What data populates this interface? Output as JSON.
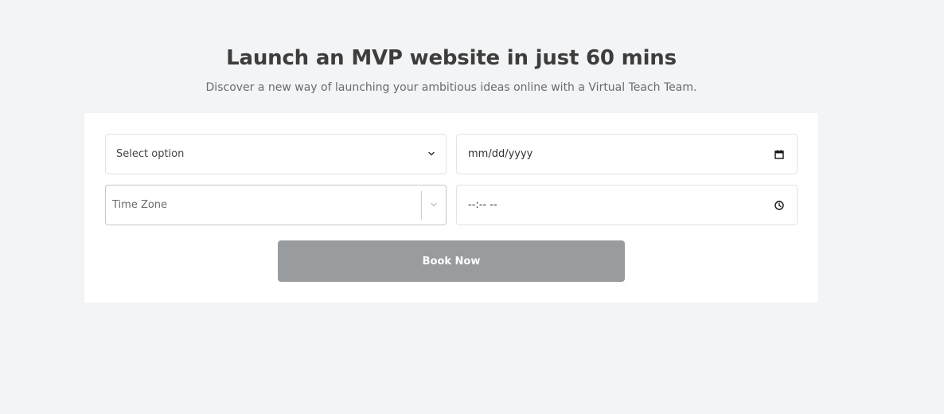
{
  "hero": {
    "title": "Launch an MVP website in just 60 mins",
    "subtitle": "Discover a new way of launching your ambitious ideas online with a Virtual Teach Team."
  },
  "form": {
    "service_select": {
      "value": "Select option"
    },
    "date_input": {
      "placeholder": "mm/dd/yyyy"
    },
    "timezone_select": {
      "placeholder": "Time Zone"
    },
    "time_input": {
      "placeholder": "--:-- --"
    },
    "submit_label": "Book Now"
  },
  "colors": {
    "page_background": "#f3f4f6",
    "card_background": "#ffffff",
    "button_background": "#999c9f",
    "title_text": "#3d3d3d"
  },
  "icons": {
    "select_chevron": "chevron-down-icon",
    "timezone_chevron": "chevron-down-icon",
    "date": "calendar-icon",
    "time": "clock-icon"
  }
}
